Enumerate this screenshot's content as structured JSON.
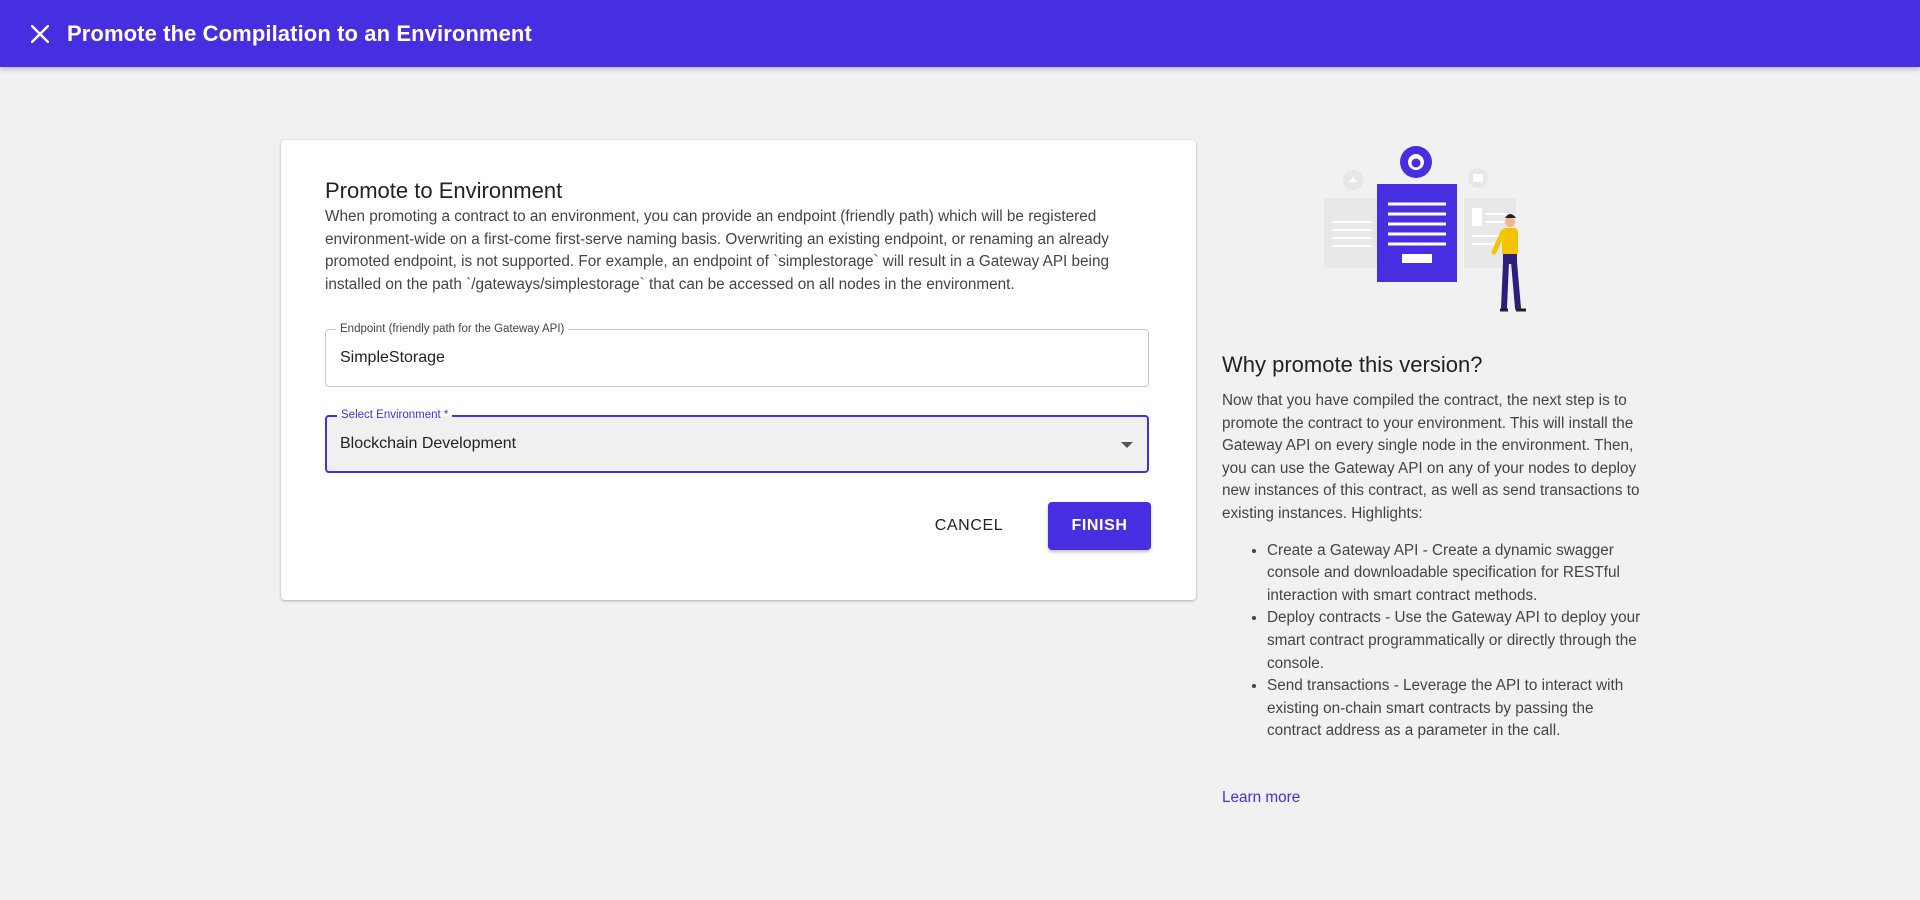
{
  "header": {
    "title": "Promote the Compilation to an Environment",
    "close_icon": "close-icon"
  },
  "colors": {
    "brand": "#472ee0",
    "accent_yellow": "#f5c400",
    "background": "#f1f1f1"
  },
  "form": {
    "title": "Promote to Environment",
    "description": "When promoting a contract to an environment, you can provide an endpoint (friendly path) which will be registered environment-wide on a first-come first-serve naming basis. Overwriting an existing endpoint, or renaming an already promoted endpoint, is not supported. For example, an endpoint of `simplestorage` will result in a Gateway API being installed on the path `/gateways/simplestorage` that can be accessed on all nodes in the environment.",
    "endpoint": {
      "label": "Endpoint (friendly path for the Gateway API)",
      "value": "SimpleStorage"
    },
    "environment": {
      "label": "Select Environment *",
      "value": "Blockchain Development"
    },
    "cancel_label": "CANCEL",
    "finish_label": "FINISH"
  },
  "side": {
    "title": "Why promote this version?",
    "text": "Now that you have compiled the contract, the next step is to promote the contract to your environment. This will install the Gateway API on every single node in the environment. Then, you can use the Gateway API on any of your nodes to deploy new instances of this contract, as well as send transactions to existing instances. Highlights:",
    "highlights": [
      "Create a Gateway API - Create a dynamic swagger console and downloadable specification for RESTful interaction with smart contract methods.",
      "Deploy contracts - Use the Gateway API to deploy your smart contract programmatically or directly through the console.",
      "Send transactions - Leverage the API to interact with existing on-chain smart contracts by passing the contract address as a parameter in the call."
    ],
    "learn_more": "Learn more"
  }
}
